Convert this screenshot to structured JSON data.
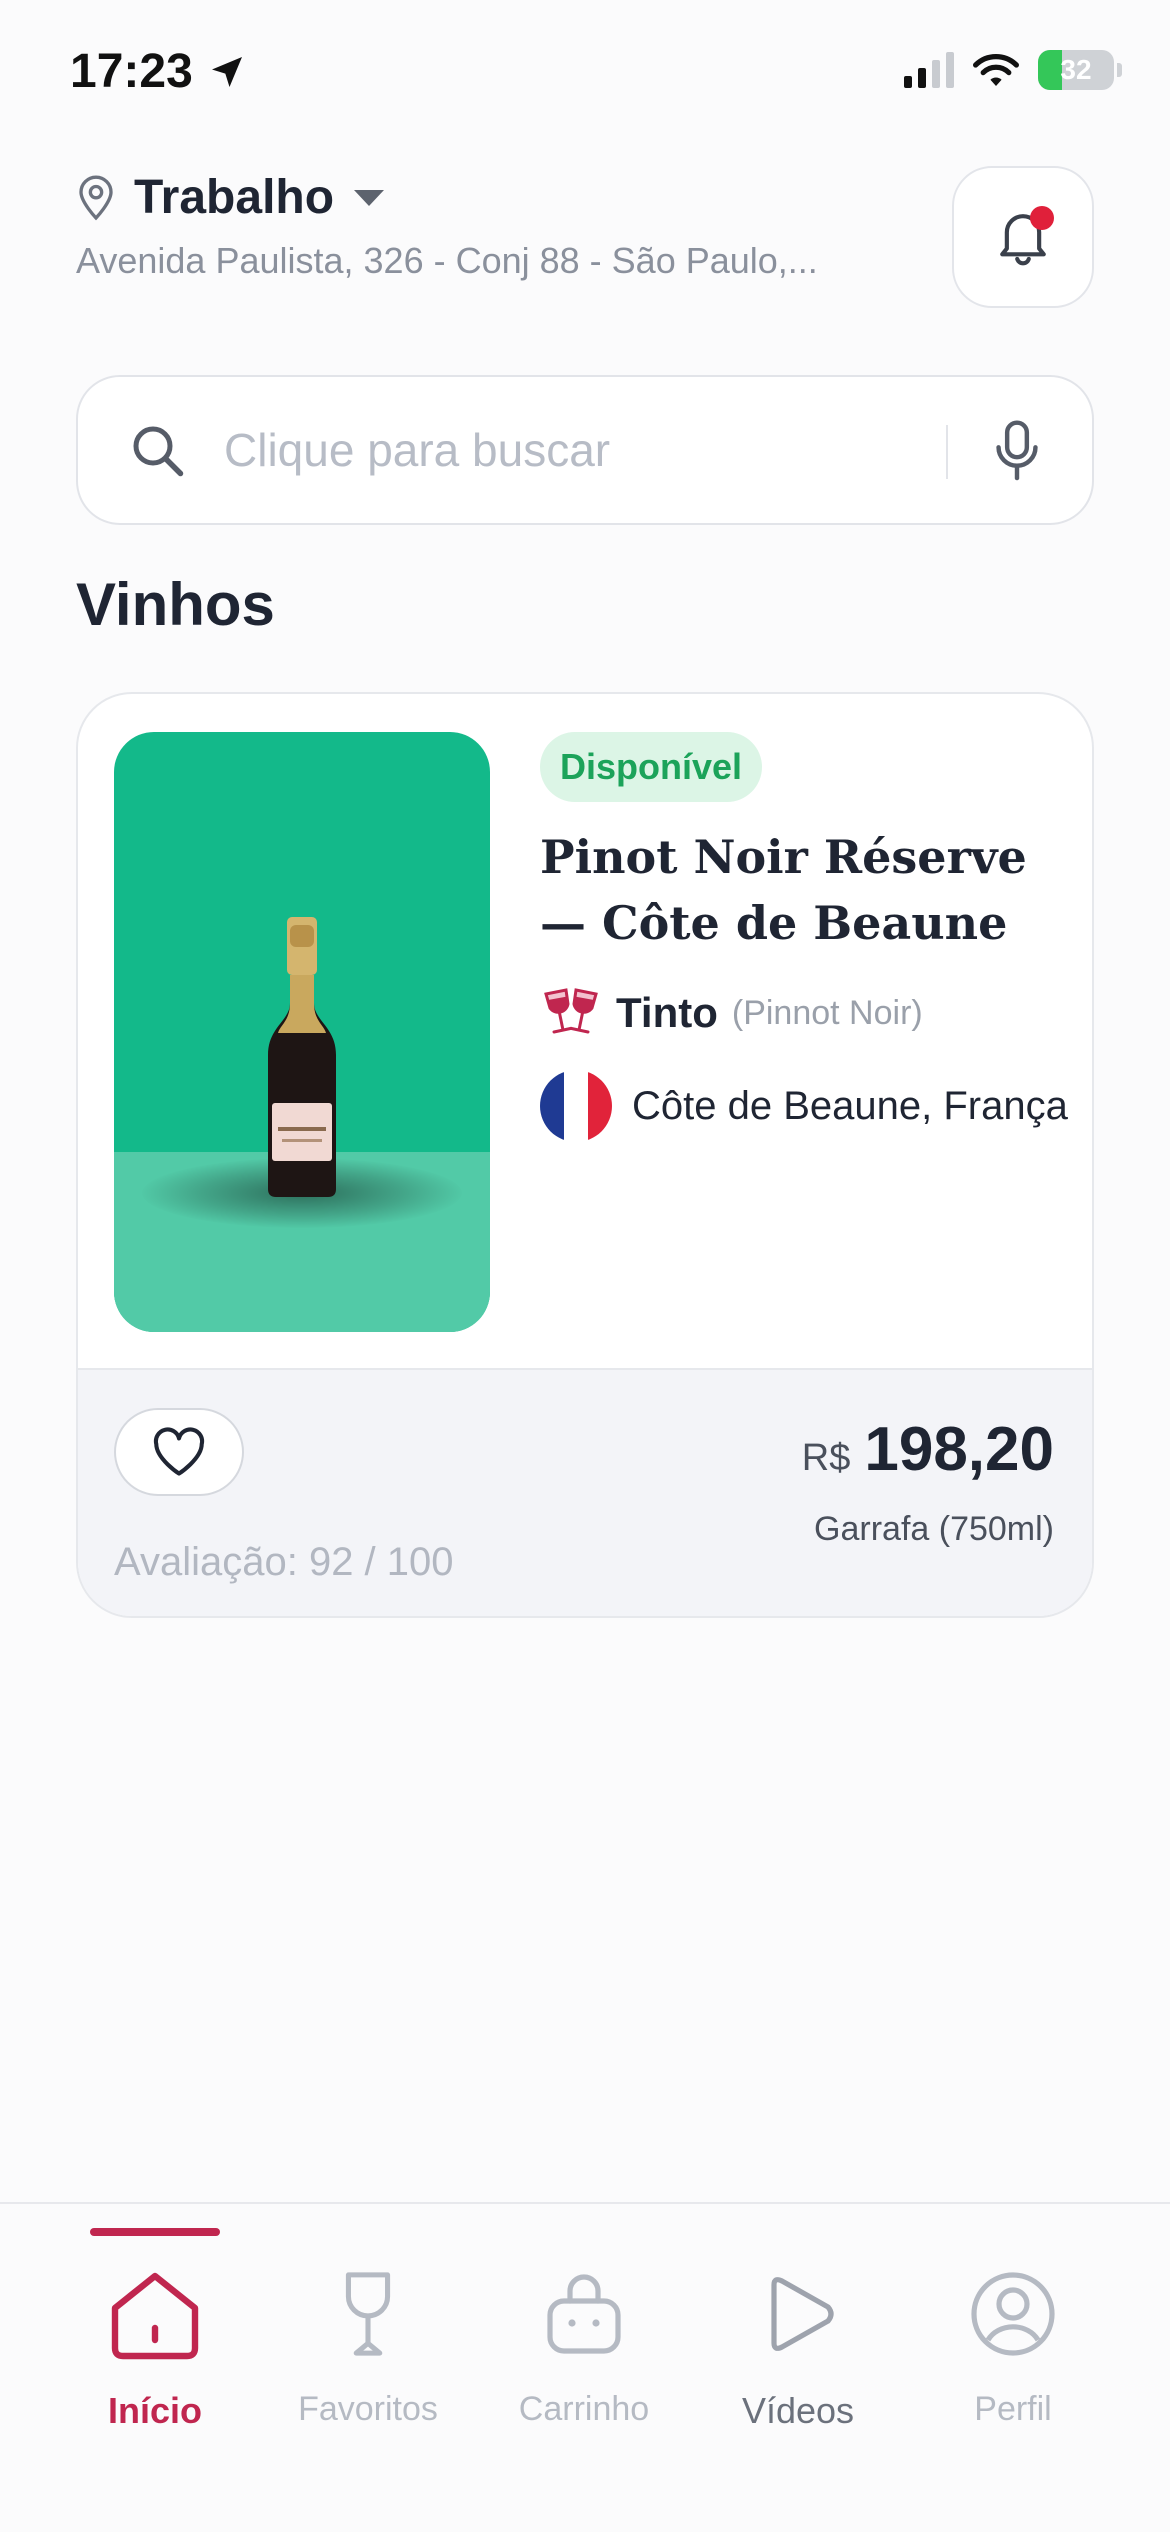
{
  "status_bar": {
    "time": "17:23",
    "battery": "32",
    "battery_level": 0.32
  },
  "location": {
    "title": "Trabalho",
    "address": "Avenida Paulista, 326 - Conj 88 - São Paulo,..."
  },
  "search": {
    "placeholder": "Clique para buscar"
  },
  "section_title": "Vinhos",
  "product": {
    "badge": "Disponível",
    "name": "Pinot Noir Réserve — Côte de Beaune",
    "type": "Tinto",
    "grape": "(Pinnot Noir)",
    "origin": "Côte de Beaune, França",
    "rating": "Avaliação: 92 / 100",
    "currency": "R$",
    "price": "198,20",
    "unit": "Garrafa (750ml)",
    "image_bg_color": "#13b98a"
  },
  "tabbar": {
    "tabs": [
      {
        "label": "Início",
        "icon": "home-icon",
        "active": true
      },
      {
        "label": "Favoritos",
        "icon": "wine-glass-icon",
        "active": false
      },
      {
        "label": "Carrinho",
        "icon": "basket-icon",
        "active": false
      },
      {
        "label": "Vídeos",
        "icon": "play-icon",
        "active": false
      },
      {
        "label": "Perfil",
        "icon": "profile-icon",
        "active": false
      }
    ]
  },
  "colors": {
    "accent": "#c0264f",
    "available_green": "#1ca35a",
    "notification_dot": "#e0203a"
  }
}
